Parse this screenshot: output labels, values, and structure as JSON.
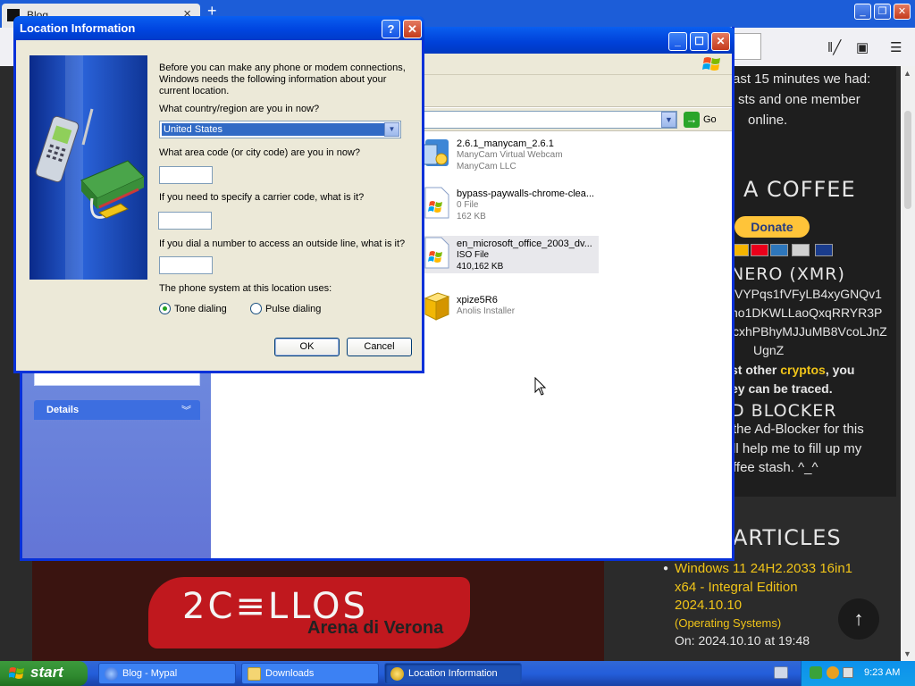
{
  "firefox": {
    "tab_title": "Blog",
    "tab_close": "×",
    "new_tab": "+",
    "sidebar": {
      "visitors_l1": "ast 15 minutes we had:",
      "visitors_l2": "sts and one member",
      "visitors_l3": "online.",
      "coffee_heading": "A COFFEE",
      "donate_label": "Donate",
      "monero_heading": "NERO (XMR)",
      "addr_l1": "VYPqs1fVFyLB4xyGNQv1",
      "addr_l2": "no1DKWLLaoQxqRRYR3P",
      "addr_l3": "cxhPBhyMJJuMB8VcoLJnZ",
      "addr_l4": "UgnZ",
      "crypto_l1a": "st other ",
      "crypto_l1b": "cryptos",
      "crypto_l1c": ", you",
      "crypto_l2": "ey can be traced.",
      "adblock_heading": "D BLOCKER",
      "adblock_l1": "the Ad-Blocker for this",
      "adblock_l2": "ll help me to fill up my",
      "adblock_l3": "ffee stash. ^_^",
      "articles_heading": "ARTICLES",
      "article_title_l1": "Windows 11 24H2.2033 16in1",
      "article_title_l2": "x64 - Integral Edition",
      "article_title_l3": "2024.10.10",
      "article_category": "(Operating Systems)",
      "article_date": "On: 2024.10.10 at 19:48"
    },
    "banner": {
      "title": "2C≡LLOS",
      "subtitle": "Arena di Verona"
    },
    "back_to_top": "↑"
  },
  "explorer": {
    "go_label": "Go",
    "details_label": "Details",
    "files": [
      {
        "name": "2.6.1_manycam_2.6.1",
        "line2": "ManyCam Virtual Webcam",
        "line3": "ManyCam LLC"
      },
      {
        "name": "bypass-paywalls-chrome-clea...",
        "line2": "0 File",
        "line3": "162 KB"
      },
      {
        "name": "en_microsoft_office_2003_dv...",
        "line2": "ISO File",
        "line3": "410,162 KB"
      },
      {
        "name": "xpize5R6",
        "line2": "Anolis Installer",
        "line3": ""
      }
    ]
  },
  "dialog": {
    "title": "Location Information",
    "help": "?",
    "close": "✕",
    "intro": "Before you can make any phone or modem connections, Windows needs the following information about your current location.",
    "q_country": "What country/region are you in now?",
    "country_value": "United States",
    "q_area": "What area code (or city code) are you in now?",
    "area_value": "",
    "q_carrier": "If you need to specify a carrier code, what is it?",
    "carrier_value": "",
    "q_outside": "If you dial a number to access an outside line, what is it?",
    "outside_value": "",
    "q_phone_system": "The phone system at this location uses:",
    "tone_label": "Tone dialing",
    "pulse_label": "Pulse dialing",
    "selected_dialing": "Tone dialing",
    "ok_label": "OK",
    "cancel_label": "Cancel"
  },
  "taskbar": {
    "start_label": "start",
    "tasks": [
      {
        "label": "Blog - Mypal"
      },
      {
        "label": "Downloads"
      },
      {
        "label": "Location Information"
      }
    ],
    "clock": "9:23 AM"
  },
  "colors": {
    "xp_blue": "#0a5ff0",
    "taskbar": "#245edb",
    "start_green": "#2f8a2f",
    "selection": "#316ac5",
    "article_link": "#f0c419"
  }
}
